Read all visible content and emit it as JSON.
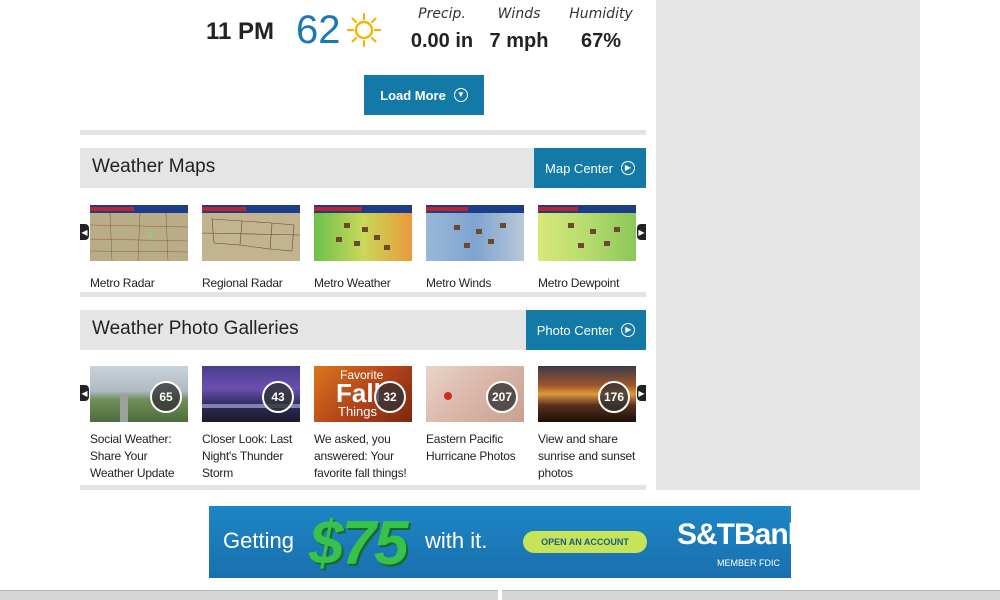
{
  "hourly": {
    "time": "11 PM",
    "temp": "62",
    "icon": "sun-icon",
    "stats": [
      {
        "label": "Precip.",
        "value": "0.00 in"
      },
      {
        "label": "Winds",
        "value": "7 mph"
      },
      {
        "label": "Humidity",
        "value": "67%"
      }
    ],
    "load_more_label": "Load More"
  },
  "weather_maps": {
    "title": "Weather Maps",
    "button_label": "Map Center",
    "items": [
      {
        "label": "Metro Radar"
      },
      {
        "label": "Regional Radar"
      },
      {
        "label": "Metro Weather"
      },
      {
        "label": "Metro Winds"
      },
      {
        "label": "Metro Dewpoint"
      }
    ]
  },
  "photo_galleries": {
    "title": "Weather Photo Galleries",
    "button_label": "Photo Center",
    "items": [
      {
        "label": "Social Weather: Share Your Weather Update",
        "count": "65"
      },
      {
        "label": "Closer Look: Last Night's Thunder Storm",
        "count": "43"
      },
      {
        "label": "We asked, you answered: Your favorite fall things!",
        "count": "32"
      },
      {
        "label": "Eastern Pacific Hurricane Photos",
        "count": "207"
      },
      {
        "label": "View and share sunrise and sunset photos",
        "count": "176"
      }
    ]
  },
  "ad": {
    "text1": "Getting",
    "amount": "$75",
    "text2": "with it.",
    "cta": "OPEN AN ACCOUNT",
    "bank": "S&TBank",
    "fdic": "MEMBER FDIC"
  },
  "colors": {
    "accent": "#137aa8",
    "temp": "#1a78b8",
    "section_bg": "#e5e5e5"
  }
}
